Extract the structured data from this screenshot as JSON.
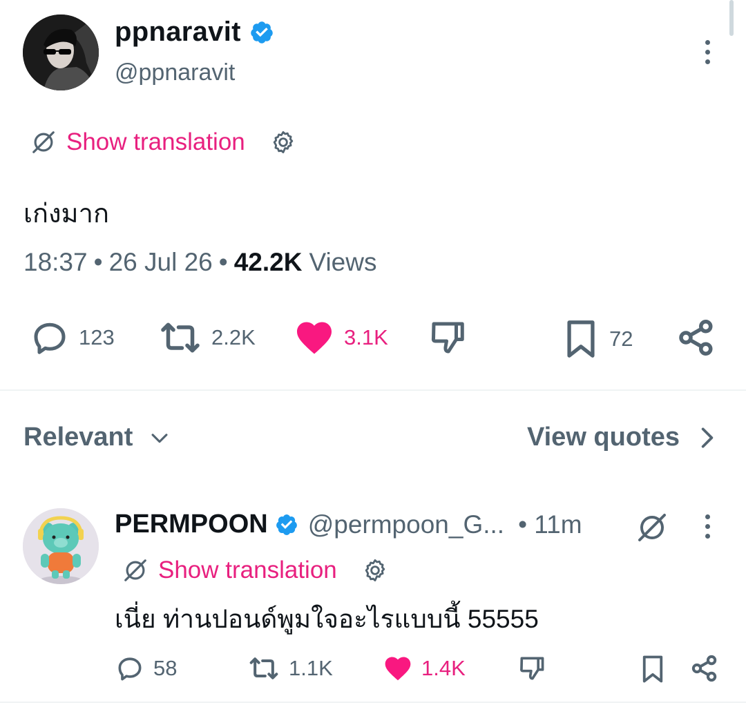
{
  "main_tweet": {
    "display_name": "ppnaravit",
    "handle": "@ppnaravit",
    "translate_label": "Show translation",
    "text": "เก่งมาก",
    "time": "18:37",
    "date": "26 Jul 26",
    "views_count": "42.2K",
    "views_label": "Views",
    "actions": {
      "replies": "123",
      "reposts": "2.2K",
      "likes": "3.1K",
      "bookmarks": "72"
    }
  },
  "sort": {
    "label": "Relevant",
    "quotes_label": "View quotes"
  },
  "reply": {
    "display_name": "PERMPOON",
    "handle": "@permpoon_G...",
    "time": "• 11m",
    "translate_label": "Show translation",
    "text": "เนี่ย ท่านปอนด์พูมใจอะไรแบบนี้ 55555",
    "actions": {
      "replies": "58",
      "reposts": "1.1K",
      "likes": "1.4K"
    }
  },
  "colors": {
    "accent_pink": "#e8207f",
    "verified_blue": "#1d9bf0",
    "secondary_text": "#536471"
  },
  "icons": [
    "verified-badge-icon",
    "more-icon",
    "translate-icon",
    "gear-icon",
    "reply-icon",
    "repost-icon",
    "heart-icon",
    "dislike-icon",
    "bookmark-icon",
    "share-icon",
    "chevron-down-icon",
    "chevron-right-icon"
  ]
}
